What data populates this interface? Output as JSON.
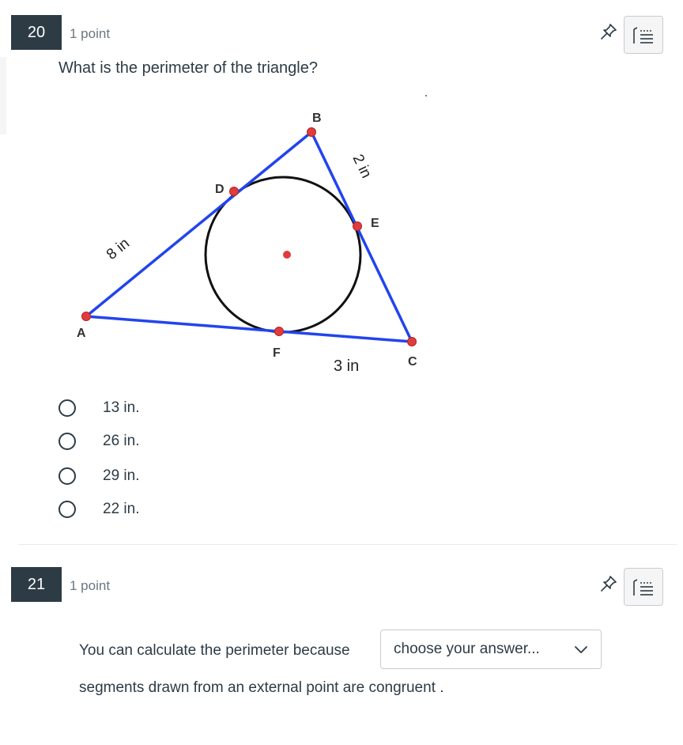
{
  "questions": [
    {
      "number": "20",
      "points": "1 point",
      "text": "What is the perimeter of the triangle?",
      "figure": {
        "point_labels": {
          "A": "A",
          "B": "B",
          "C": "C",
          "D": "D",
          "E": "E",
          "F": "F"
        },
        "length_labels": {
          "AD": "8 in",
          "BE": "2 in",
          "CF": "3 in"
        },
        "colors": {
          "triangle": "#2244ee",
          "circle": "#111111",
          "points": "#e23b3b"
        }
      },
      "options": [
        {
          "label": "13 in.",
          "selected": false
        },
        {
          "label": "26 in.",
          "selected": false
        },
        {
          "label": "29 in.",
          "selected": false
        },
        {
          "label": "22 in.",
          "selected": false
        }
      ]
    },
    {
      "number": "21",
      "points": "1 point",
      "text_before": "You can calculate the perimeter because",
      "select_value": "choose your answer...",
      "text_after": "segments drawn from an external point are congruent ."
    }
  ],
  "icons": {
    "pin": "pin-icon",
    "notes": "notes-icon",
    "dropdown": "chevron-down-icon"
  }
}
